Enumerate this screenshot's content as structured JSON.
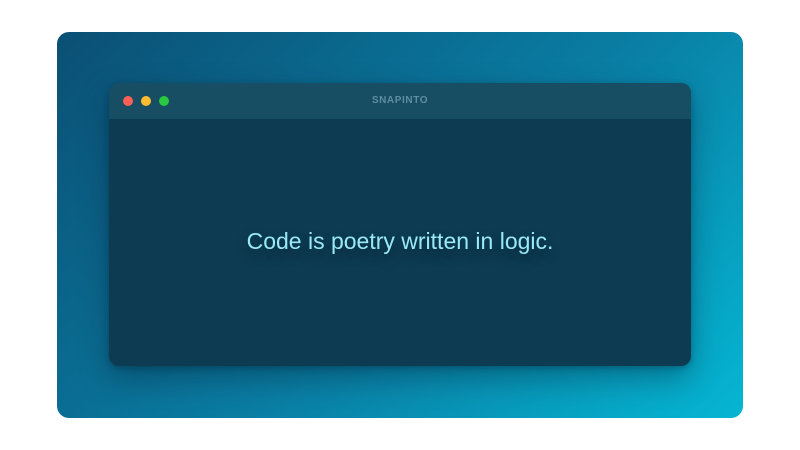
{
  "window": {
    "title": "SNAPINTO",
    "controls": {
      "close": {
        "icon": "close-dot-icon",
        "color": "#ff5f57"
      },
      "minimize": {
        "icon": "minimize-dot-icon",
        "color": "#febc2e"
      },
      "zoom": {
        "icon": "zoom-dot-icon",
        "color": "#28c840"
      }
    }
  },
  "content": {
    "text": "Code is poetry written in logic."
  },
  "colors": {
    "backdrop_start": "#0b4f74",
    "backdrop_end": "#05b6d3",
    "window_body": "#0d3b52",
    "titlebar": "#174e64",
    "text": "#9ae9f6"
  }
}
